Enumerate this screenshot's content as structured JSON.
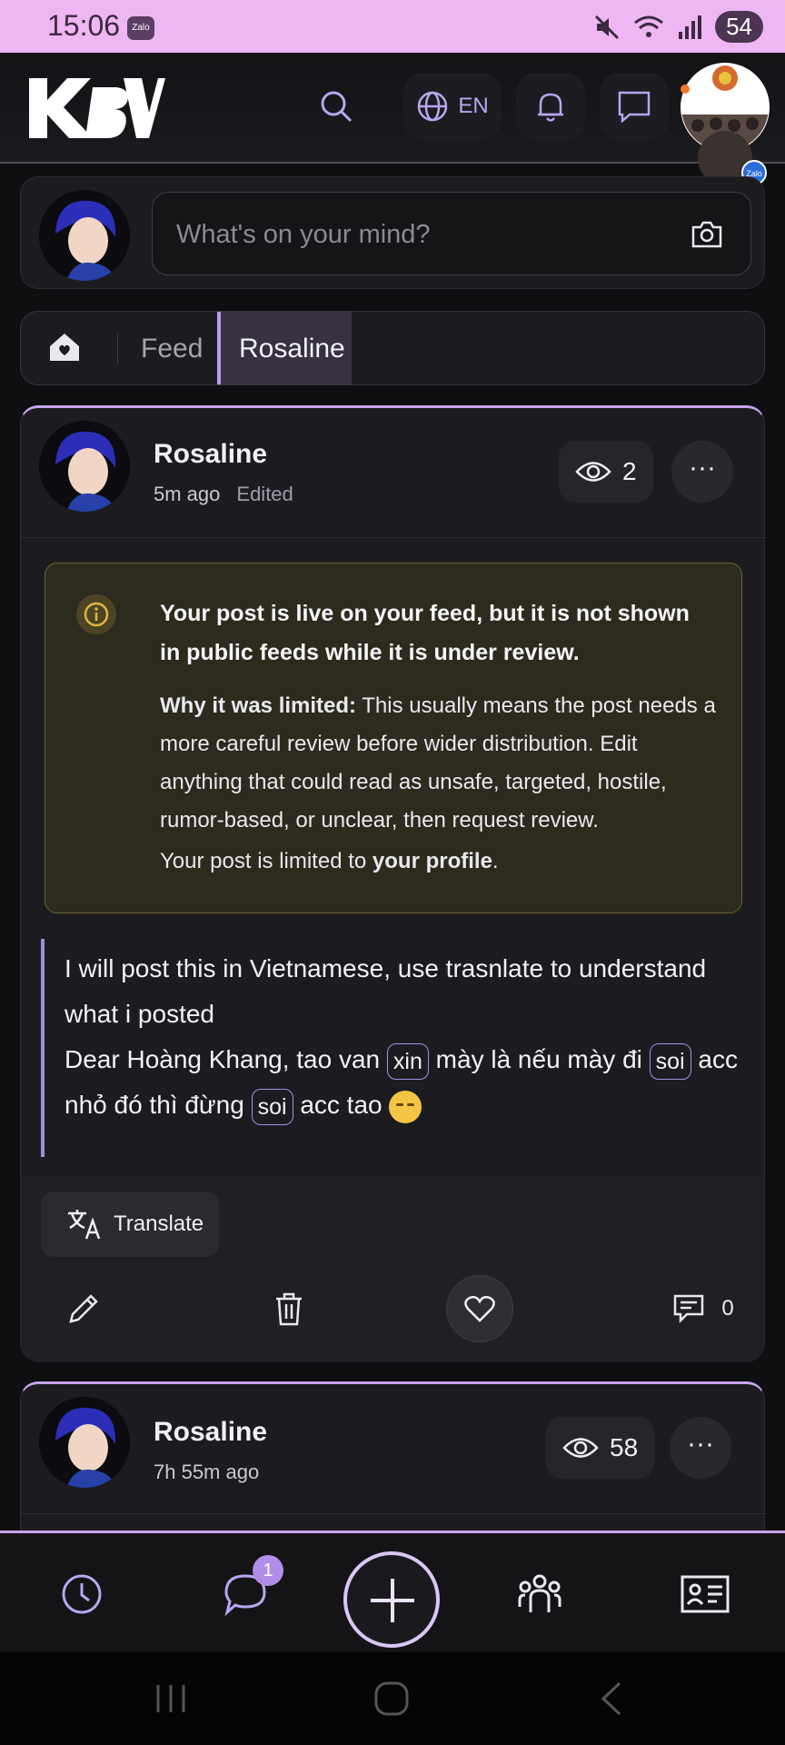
{
  "status_bar": {
    "time": "15:06",
    "zalo": "Zalo",
    "battery": "54"
  },
  "header": {
    "language": "EN"
  },
  "composer": {
    "placeholder": "What's on your mind?"
  },
  "tabs": {
    "feed": "Feed",
    "active": "Rosaline"
  },
  "post": {
    "author": "Rosaline",
    "time": "5m ago",
    "edited": "Edited",
    "views": "2",
    "notice": {
      "title": "Your post is live on your feed, but it is not shown in public feeds while it is under review.",
      "why_label": "Why it was limited:",
      "why_text": " This usually means the post needs a more careful review before wider distribution. Edit anything that could read as unsafe, targeted, hostile, rumor-based, or unclear, then request review.",
      "limit_prefix": "Your post is limited to ",
      "limit_bold": "your profile",
      "limit_suffix": "."
    },
    "body": {
      "line1": "I will post this in Vietnamese, use trasnlate to understand what i posted",
      "part1": "Dear Hoàng Khang, tao van ",
      "chip1": "xin",
      "part2": " mày là nếu mày đi ",
      "chip2": "soi",
      "part3": " acc nhỏ đó thì đừng ",
      "chip3": "soi",
      "part4": " acc tao "
    },
    "translate": "Translate",
    "comments": "0"
  },
  "post2": {
    "author": "Rosaline",
    "time": "7h 55m ago",
    "views": "58"
  },
  "bottom_nav": {
    "chat_badge": "1"
  },
  "colors": {
    "accent": "#c6a5ee",
    "status_bar": "#eeb6f2",
    "notice_bg": "#2d2a1e"
  }
}
